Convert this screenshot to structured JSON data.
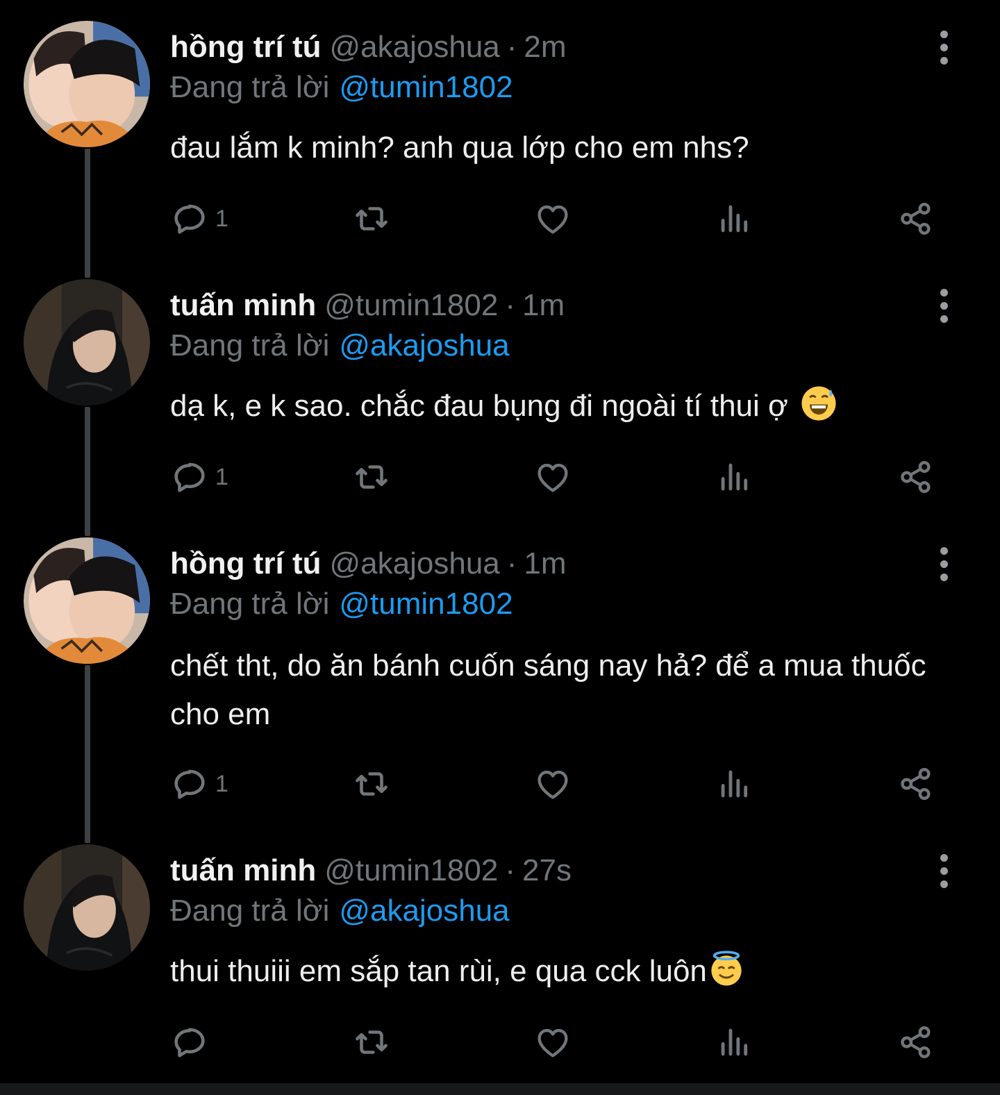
{
  "theme": {
    "background": "#000000",
    "text": "#e7e9ea",
    "muted": "#71767b",
    "link": "#1d9bf0",
    "thread_line": "#3e4144"
  },
  "tweets": [
    {
      "display_name": "hồng trí tú",
      "handle": "@akajoshua",
      "separator": "·",
      "time": "2m",
      "reply_prefix": "Đang trả lời",
      "reply_to": "@tumin1802",
      "text": "đau lắm k minh? anh qua lớp cho em nhs?",
      "emoji": "",
      "reply_count": "1",
      "avatar": "avatar-couple"
    },
    {
      "display_name": "tuấn minh",
      "handle": "@tumin1802",
      "separator": "·",
      "time": "1m",
      "reply_prefix": "Đang trả lời",
      "reply_to": "@akajoshua",
      "text": "dạ k, e k sao. chắc đau bụng đi ngoài tí thui ợ",
      "emoji": "grinning-sweat",
      "reply_count": "1",
      "avatar": "avatar-hoodie"
    },
    {
      "display_name": "hồng trí tú",
      "handle": "@akajoshua",
      "separator": "·",
      "time": "1m",
      "reply_prefix": "Đang trả lời",
      "reply_to": "@tumin1802",
      "text": "chết tht, do ăn bánh cuốn sáng nay hả? để a mua thuốc cho em",
      "emoji": "",
      "reply_count": "1",
      "avatar": "avatar-couple"
    },
    {
      "display_name": "tuấn minh",
      "handle": "@tumin1802",
      "separator": "·",
      "time": "27s",
      "reply_prefix": "Đang trả lời",
      "reply_to": "@akajoshua",
      "text": "thui thuiii em sắp tan rùi, e qua cck luôn",
      "emoji": "smiling-halo",
      "reply_count": "",
      "avatar": "avatar-hoodie"
    }
  ],
  "action_icons": [
    "reply-icon",
    "retweet-icon",
    "like-icon",
    "views-icon",
    "share-icon"
  ]
}
